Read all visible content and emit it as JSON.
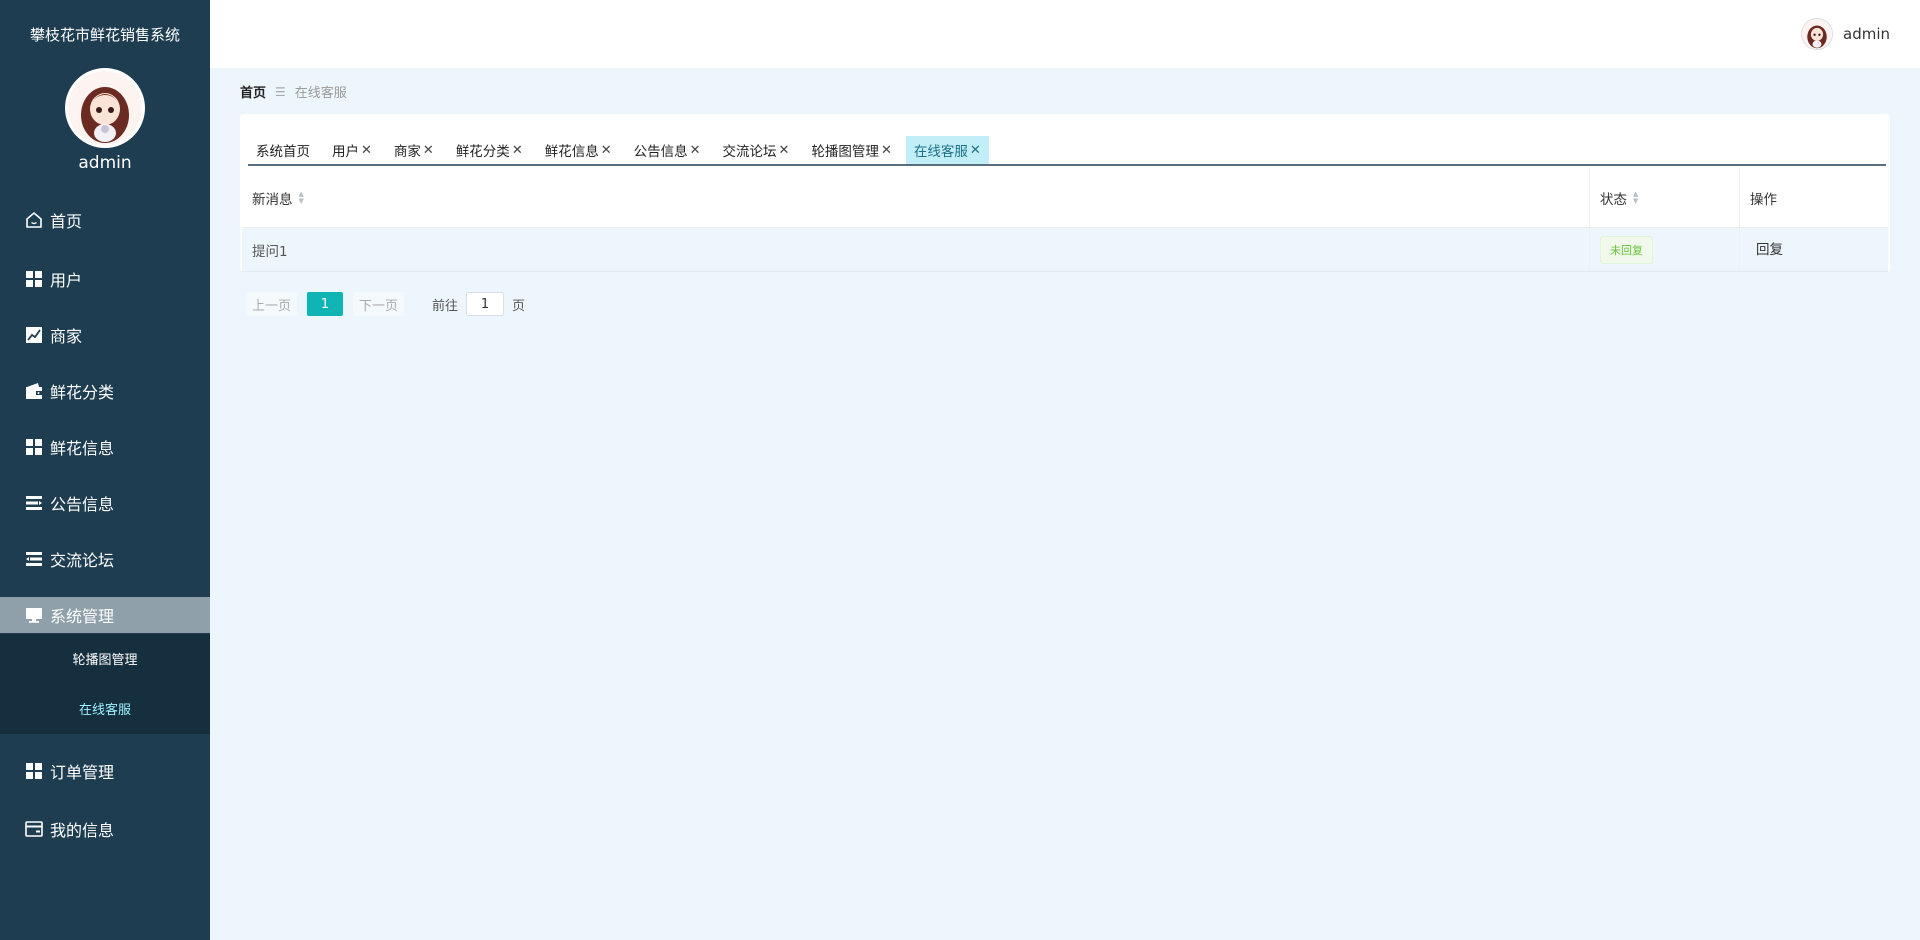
{
  "sidebar": {
    "app_title": "攀枝花市鲜花销售系统",
    "admin_name": "admin",
    "items": [
      {
        "label": "首页",
        "icon": "home-icon"
      },
      {
        "label": "用户",
        "icon": "grid-icon"
      },
      {
        "label": "商家",
        "icon": "chart-icon"
      },
      {
        "label": "鲜花分类",
        "icon": "wallet-icon"
      },
      {
        "label": "鲜花信息",
        "icon": "grid-icon"
      },
      {
        "label": "公告信息",
        "icon": "list-icon"
      },
      {
        "label": "交流论坛",
        "icon": "list-indent-icon"
      },
      {
        "label": "系统管理",
        "icon": "monitor-icon"
      },
      {
        "label": "订单管理",
        "icon": "grid-icon"
      },
      {
        "label": "我的信息",
        "icon": "card-icon"
      }
    ],
    "submenu": [
      {
        "label": "轮播图管理"
      },
      {
        "label": "在线客服"
      }
    ]
  },
  "header": {
    "username": "admin"
  },
  "breadcrumb": {
    "home": "首页",
    "separator": "☰",
    "current": "在线客服"
  },
  "tabs": [
    {
      "label": "系统首页",
      "closable": false
    },
    {
      "label": "用户",
      "closable": true
    },
    {
      "label": "商家",
      "closable": true
    },
    {
      "label": "鲜花分类",
      "closable": true
    },
    {
      "label": "鲜花信息",
      "closable": true
    },
    {
      "label": "公告信息",
      "closable": true
    },
    {
      "label": "交流论坛",
      "closable": true
    },
    {
      "label": "轮播图管理",
      "closable": true
    },
    {
      "label": "在线客服",
      "closable": true
    }
  ],
  "table": {
    "columns": [
      "新消息",
      "状态",
      "操作"
    ],
    "rows": [
      {
        "message": "提问1",
        "status": "未回复",
        "action": "回复"
      }
    ]
  },
  "pagination": {
    "prev": "上一页",
    "current_page": "1",
    "next": "下一页",
    "goto_label": "前往",
    "goto_value": "1",
    "goto_suffix": "页"
  },
  "colors": {
    "sidebar_bg": "#1e3d51",
    "accent": "#0fb5b5",
    "active_tab": "#c2eef8",
    "status_green": "#67c23a"
  }
}
